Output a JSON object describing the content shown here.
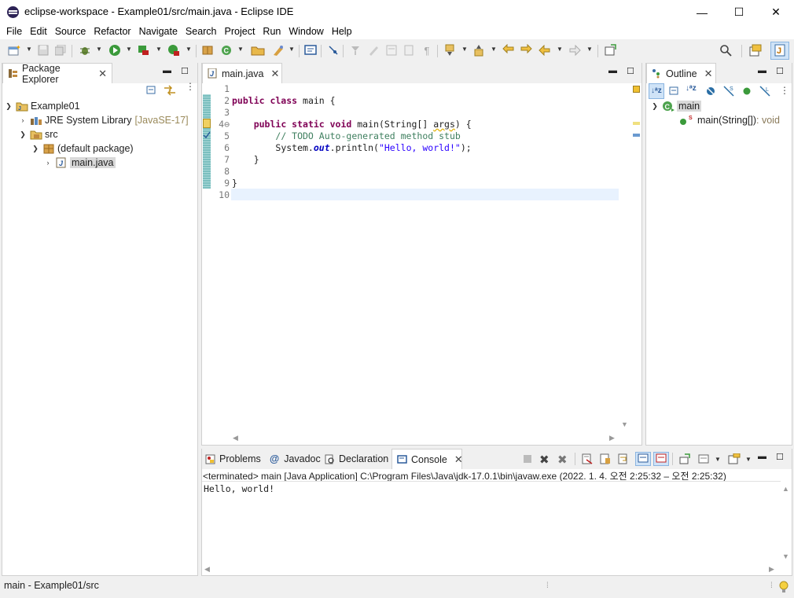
{
  "window": {
    "title": "eclipse-workspace - Example01/src/main.java - Eclipse IDE",
    "controls": {
      "minimize": "—",
      "maximize": "☐",
      "close": "✕"
    }
  },
  "menu": [
    "File",
    "Edit",
    "Source",
    "Refactor",
    "Navigate",
    "Search",
    "Project",
    "Run",
    "Window",
    "Help"
  ],
  "package_explorer": {
    "tab_label": "Package Explorer",
    "tree": {
      "project": "Example01",
      "jre_label": "JRE System Library",
      "jre_version": "[JavaSE-17]",
      "src": "src",
      "package": "(default package)",
      "file": "main.java"
    }
  },
  "editor": {
    "tab_label": "main.java",
    "line_numbers": [
      "1",
      "2",
      "3",
      "4⊖",
      "5",
      "6",
      "7",
      "8",
      "9",
      "10"
    ],
    "code": {
      "l2_kw": "public class",
      "l2_rest": " main {",
      "l4_kw": "public static void",
      "l4_a": " main(String[] ",
      "l4_arg": "args",
      "l4_b": ") {",
      "l5": "// TODO Auto-generated method stub",
      "l6_a": "System.",
      "l6_field": "out",
      "l6_b": ".println(",
      "l6_str": "\"Hello, world!\"",
      "l6_c": ");",
      "l7": "}",
      "l9": "}"
    }
  },
  "outline": {
    "tab_label": "Outline",
    "class_name": "main",
    "method_name": "main(String[])",
    "method_type": " : void",
    "static_marker": "S"
  },
  "bottom_tabs": {
    "problems": "Problems",
    "javadoc": "Javadoc",
    "declaration": "Declaration",
    "console": "Console"
  },
  "console": {
    "status": "<terminated> main [Java Application] C:\\Program Files\\Java\\jdk-17.0.1\\bin\\javaw.exe  (2022. 1. 4. 오전 2:25:32 – 오전 2:25:32)",
    "output": "Hello, world!"
  },
  "statusbar": {
    "text": "main - Example01/src"
  },
  "colors": {
    "keyword": "#7f0055",
    "comment": "#3f7f5f",
    "string": "#2a00ff",
    "current_line": "#e8f2fe"
  }
}
